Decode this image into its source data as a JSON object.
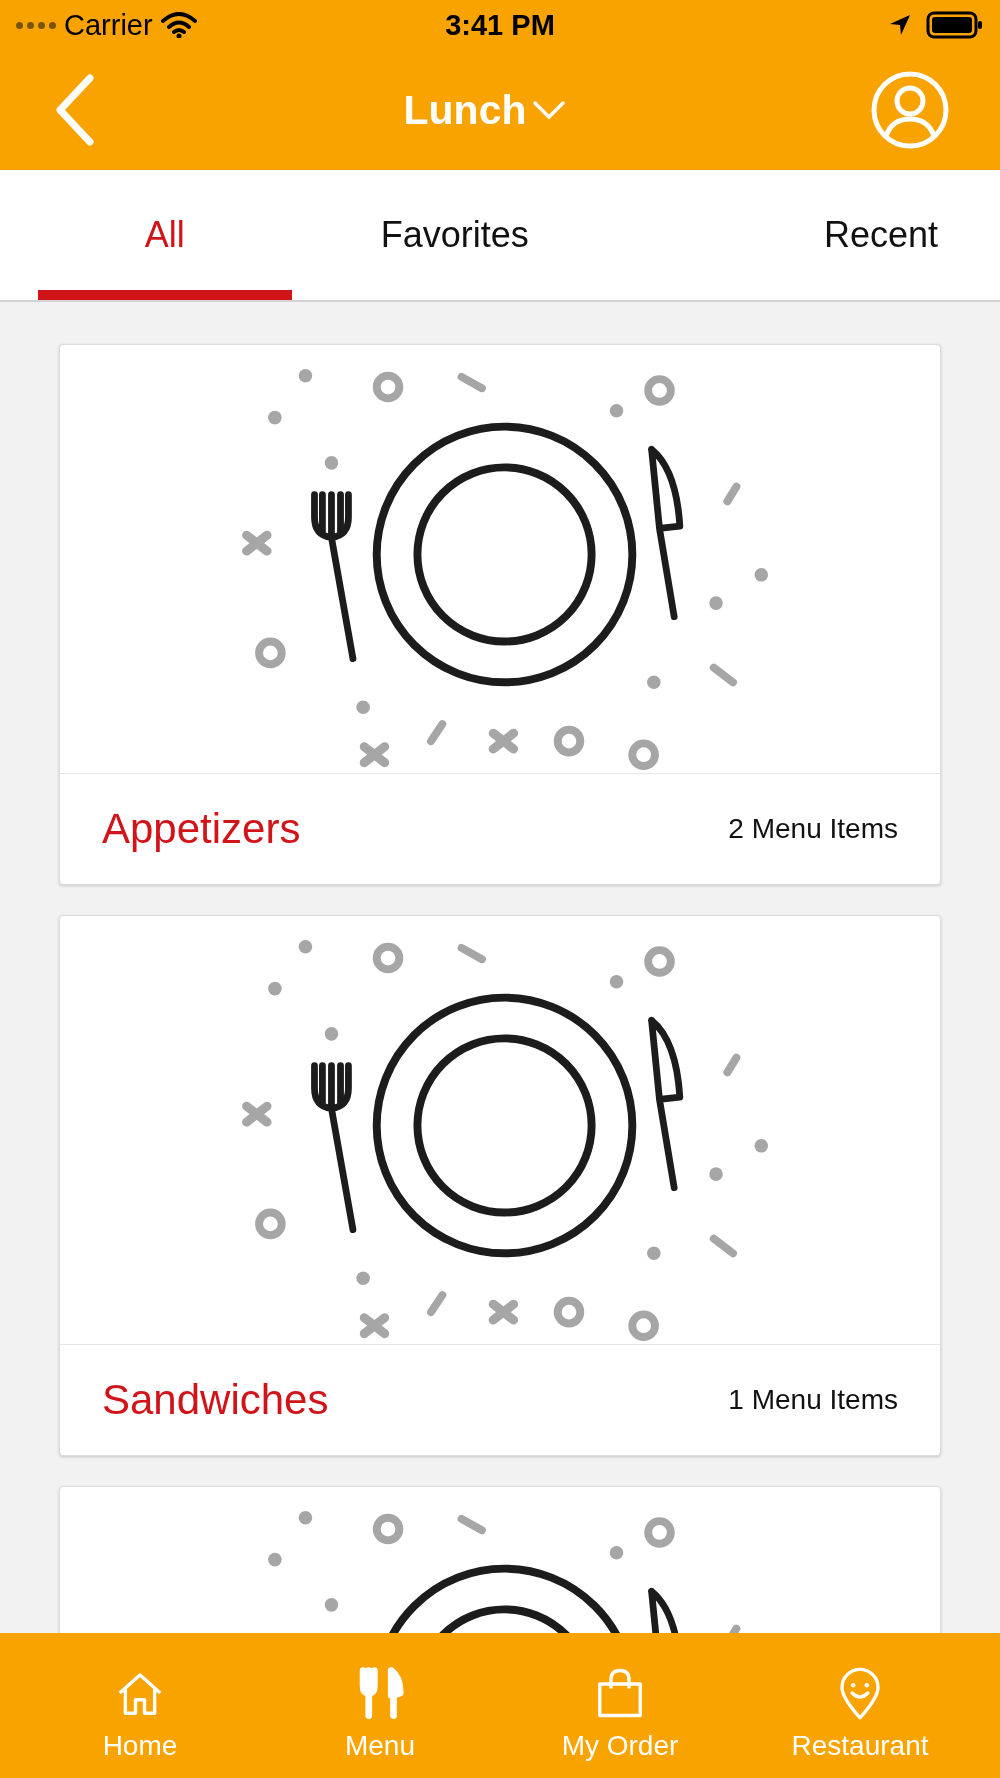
{
  "status_bar": {
    "carrier": "Carrier",
    "time": "3:41 PM"
  },
  "header": {
    "title": "Lunch"
  },
  "tabs": [
    {
      "label": "All",
      "selected": true
    },
    {
      "label": "Favorites",
      "selected": false
    },
    {
      "label": "Recent",
      "selected": false
    }
  ],
  "cards": [
    {
      "kind": "full",
      "title": "Appetizers",
      "count": "2 Menu Items"
    },
    {
      "kind": "full",
      "title": "Sandwiches",
      "count": "1 Menu Items"
    },
    {
      "kind": "partial"
    }
  ],
  "bottom_nav": [
    {
      "label": "Home",
      "kind": "home",
      "selected": false
    },
    {
      "label": "Menu",
      "kind": "menu",
      "selected": true
    },
    {
      "label": "My Order",
      "kind": "bag",
      "selected": false
    },
    {
      "label": "Restaurant",
      "kind": "pin",
      "selected": false
    }
  ]
}
